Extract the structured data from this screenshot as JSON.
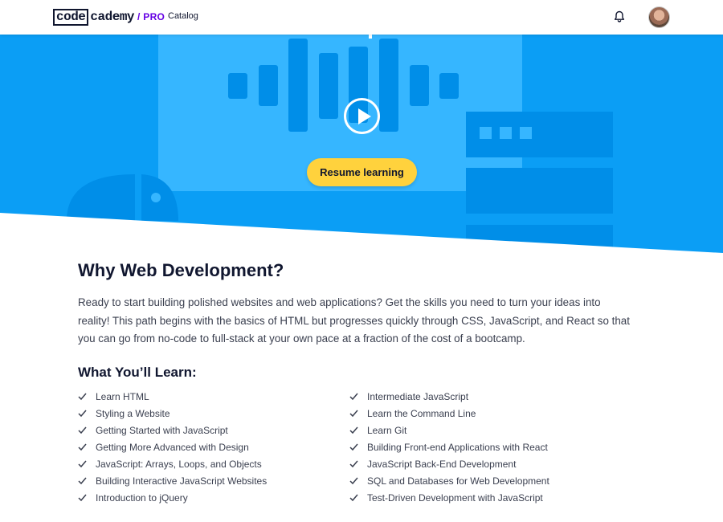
{
  "header": {
    "logo": {
      "code": "code",
      "cademy": "cademy",
      "pro": "/ PRO"
    },
    "nav": {
      "catalog": "Catalog"
    }
  },
  "hero": {
    "resume_label": "Resume learning",
    "colors": {
      "background": "#0b9ef5",
      "shapes": "#008ee8",
      "panel": "#36b6ff",
      "button": "#ffd23d"
    }
  },
  "main": {
    "title": "Why Web Development?",
    "description": "Ready to start building polished websites and web applications? Get the skills you need to turn your ideas into reality! This path begins with the basics of HTML but progresses quickly through CSS, JavaScript, and React so that you can go from no-code to full-stack at your own pace at a fraction of the cost of a bootcamp.",
    "learn_title": "What You’ll Learn:",
    "learn_left": [
      "Learn HTML",
      "Styling a Website",
      "Getting Started with JavaScript",
      "Getting More Advanced with Design",
      "JavaScript: Arrays, Loops, and Objects",
      "Building Interactive JavaScript Websites",
      "Introduction to jQuery"
    ],
    "learn_right": [
      "Intermediate JavaScript",
      "Learn the Command Line",
      "Learn Git",
      "Building Front-end Applications with React",
      "JavaScript Back-End Development",
      "SQL and Databases for Web Development",
      "Test-Driven Development with JavaScript"
    ]
  },
  "icons": [
    "bell-icon",
    "avatar",
    "play-icon",
    "check-icon"
  ]
}
